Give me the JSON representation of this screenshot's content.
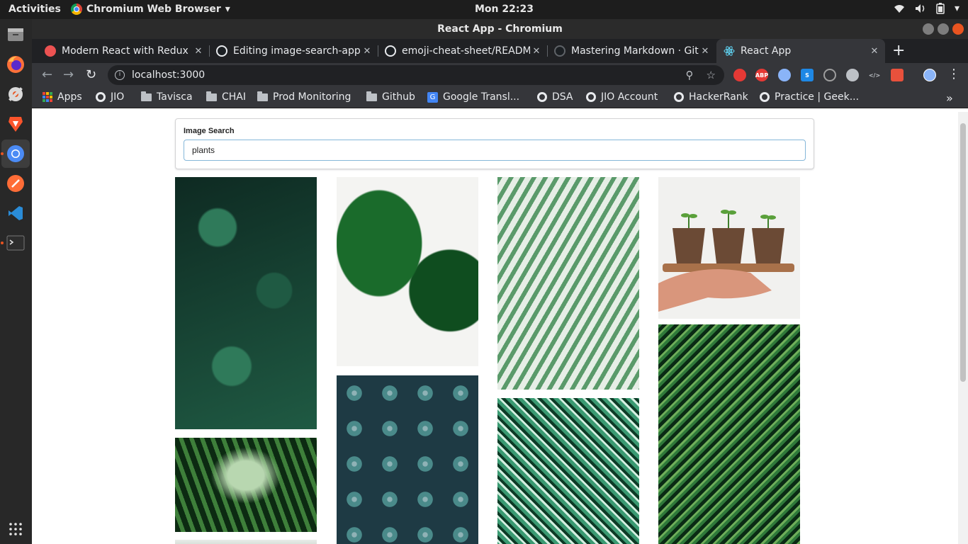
{
  "topbar": {
    "activities": "Activities",
    "app_name": "Chromium Web Browser",
    "clock": "Mon 22:23"
  },
  "window": {
    "title": "React App - Chromium"
  },
  "tabs": [
    {
      "title": "Modern React with Redux",
      "favicon_color": "#ec5252",
      "active": false
    },
    {
      "title": "Editing image-search-app",
      "favicon_color": "#1b1f23",
      "active": false
    },
    {
      "title": "emoji-cheat-sheet/README",
      "favicon_color": "#1b1f23",
      "active": false
    },
    {
      "title": "Mastering Markdown · GitHub",
      "favicon_color": "#1b1f23",
      "active": false
    },
    {
      "title": "React App",
      "favicon_color": "#61dafb",
      "active": true
    }
  ],
  "toolbar": {
    "url": "localhost:3000"
  },
  "extensions": [
    {
      "name": "stop-extension",
      "label": "",
      "color": "#e53935"
    },
    {
      "name": "adblock-plus",
      "label": "ABP",
      "color": "#e53935"
    },
    {
      "name": "circle-extension",
      "label": "",
      "color": "#8ab4f8"
    },
    {
      "name": "s-extension",
      "label": "S",
      "color": "#1e88e5"
    },
    {
      "name": "target-extension",
      "label": "",
      "color": "#9e9e9e"
    },
    {
      "name": "clock-extension",
      "label": "",
      "color": "#bdc1c6"
    },
    {
      "name": "code-extension",
      "label": "</>",
      "color": "#35363a"
    },
    {
      "name": "puzzle-extension",
      "label": "",
      "color": "#e8513c"
    }
  ],
  "bookmarks": [
    {
      "label": "Apps",
      "kind": "apps"
    },
    {
      "label": "JIO",
      "kind": "globe"
    },
    {
      "label": "Tavisca",
      "kind": "folder"
    },
    {
      "label": "CHAI",
      "kind": "folder"
    },
    {
      "label": "Prod Monitoring",
      "kind": "folder"
    },
    {
      "label": "Github",
      "kind": "folder"
    },
    {
      "label": "Google Transl...",
      "kind": "translate"
    },
    {
      "label": "DSA",
      "kind": "globe"
    },
    {
      "label": "JIO Account",
      "kind": "globe"
    },
    {
      "label": "HackerRank",
      "kind": "globe"
    },
    {
      "label": "Practice | Geek...",
      "kind": "globe"
    }
  ],
  "search": {
    "label": "Image Search",
    "value": "plants"
  },
  "images": [
    {
      "name": "dark-green-leaves",
      "colors": [
        "#0e2a22",
        "#1f5a43",
        "#2f7a5a"
      ]
    },
    {
      "name": "monstera-leaves",
      "colors": [
        "#f4f4f2",
        "#1a6b2b",
        "#0f4d1f"
      ]
    },
    {
      "name": "palm-fronds-blur",
      "colors": [
        "#e6eee6",
        "#5a9a6a",
        "#2e6b46"
      ]
    },
    {
      "name": "seedlings-in-pots",
      "colors": [
        "#f1f1ef",
        "#6b4a35",
        "#c9956a"
      ]
    },
    {
      "name": "jungle-greenhouse",
      "colors": [
        "#0c2a12",
        "#3e7f3a",
        "#b8d7b0"
      ]
    },
    {
      "name": "succulents",
      "colors": [
        "#1e3a44",
        "#4a8a8a",
        "#8fb2b6"
      ]
    },
    {
      "name": "calathea-leaves",
      "colors": [
        "#0d3a26",
        "#3a9a72",
        "#d3efe0"
      ]
    },
    {
      "name": "fern-palm-leaves",
      "colors": [
        "#0a2a14",
        "#2f7a3a",
        "#6fae5a"
      ]
    },
    {
      "name": "partial-image",
      "colors": [
        "#e8ece8",
        "#d9e2dc",
        "#cfd9d2"
      ]
    }
  ]
}
